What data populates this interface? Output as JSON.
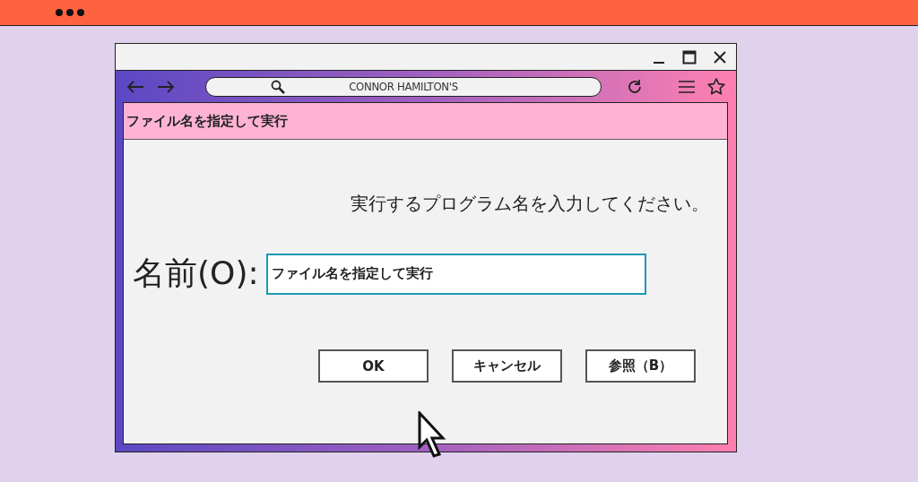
{
  "browser": {
    "address": "CONNOR HAMILTON'S"
  },
  "dialog": {
    "title": "ファイル名を指定して実行",
    "prompt": "実行するプログラム名を入力してください。",
    "field_label": "名前(O):",
    "field_value": "ファイル名を指定して実行",
    "buttons": [
      "OK",
      "キャンセル",
      "参照（B）"
    ]
  }
}
